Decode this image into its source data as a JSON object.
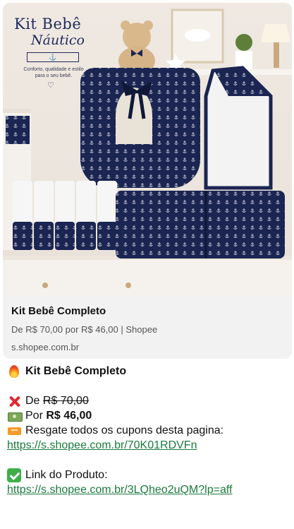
{
  "preview": {
    "image": {
      "brand_title": "Kit Bebê",
      "brand_subtitle": "Náutico",
      "brand_tagline": "Conforto, qualidade e estilo para o seu bebê."
    },
    "title": "Kit Bebê Completo",
    "description": "De R$ 70,00 por R$ 46,00 | Shopee",
    "domain": "s.shopee.com.br"
  },
  "message": {
    "headline": {
      "icon": "fire-icon",
      "text": "Kit Bebê Completo"
    },
    "old_price": {
      "icon": "cross-mark-icon",
      "prefix": "De",
      "value": "R$ 70,00"
    },
    "new_price": {
      "icon": "money-icon",
      "prefix": "Por",
      "value": "R$ 46,00"
    },
    "coupons": {
      "icon": "ticket-icon",
      "text": "Resgate todos os cupons desta pagina:",
      "url": "https://s.shopee.com.br/70K01RDVFn"
    },
    "product": {
      "icon": "check-mark-icon",
      "text": "Link do Produto:",
      "url": "https://s.shopee.com.br/3LQheo2uQM?lp=aff"
    }
  },
  "colors": {
    "navy": "#1e2a5a",
    "link": "#1a7a3d",
    "card_bg": "#f2f2f2"
  }
}
